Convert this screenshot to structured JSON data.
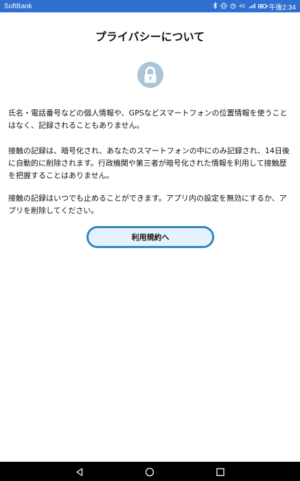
{
  "status_bar": {
    "carrier": "SoftBank",
    "time": "午後2:34",
    "network": "4G",
    "icons": [
      "bluetooth-icon",
      "vibrate-icon",
      "alarm-icon",
      "signal-icon",
      "battery-icon"
    ]
  },
  "page": {
    "title": "プライバシーについて",
    "lock_icon": "lock-icon",
    "paragraph1": "氏名・電話番号などの個人情報や、GPSなどスマートフォンの位置情報を使うことはなく、記録されることもありません。",
    "paragraph2": "接触の記録は、暗号化され、あなたのスマートフォンの中にのみ記録され、14日後に自動的に削除されます。行政機関や第三者が暗号化された情報を利用して接触歴を把握することはありません。",
    "paragraph3": "接触の記録はいつでも止めることができます。アプリ内の設定を無効にするか、アプリを削除してください。",
    "terms_button_label": "利用規約へ"
  },
  "nav_bar": {
    "icons": [
      "back-icon",
      "home-icon",
      "recent-apps-icon"
    ]
  },
  "colors": {
    "status_bar": "#2f6fd0",
    "lock_icon": "#a9c5d6",
    "button_border": "#2e86c1",
    "button_fill": "#e6f1fb"
  }
}
